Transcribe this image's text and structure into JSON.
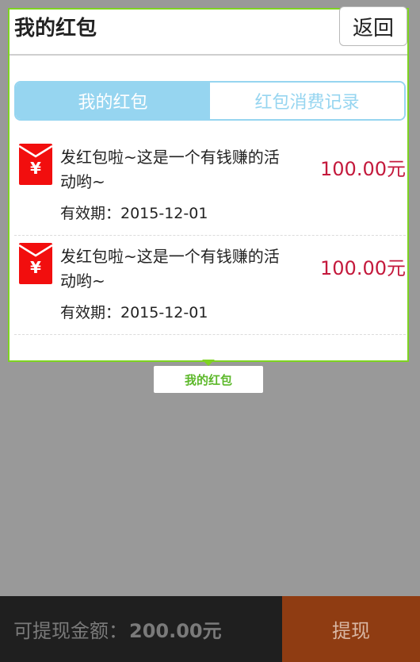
{
  "header": {
    "title": "我的红包",
    "back_label": "返回"
  },
  "tabs": [
    {
      "label": "我的红包",
      "active": true
    },
    {
      "label": "红包消费记录",
      "active": false
    }
  ],
  "envelopes": [
    {
      "description": "发红包啦~这是一个有钱赚的活动哟~",
      "expiry": "有效期：2015-12-01",
      "amount": "100.00元"
    },
    {
      "description": "发红包啦~这是一个有钱赚的活动哟~",
      "expiry": "有效期：2015-12-01",
      "amount": "100.00元"
    }
  ],
  "icon": {
    "envelope_symbol": "¥"
  },
  "tooltip": {
    "label": "我的红包"
  },
  "footer": {
    "balance_label": "可提现金额：",
    "balance_value": "200.00元",
    "withdraw_label": "提现"
  },
  "colors": {
    "highlight_border": "#7ed321",
    "tab_accent": "#96d5f0",
    "amount": "#c4193c",
    "envelope_red": "#f20e0e",
    "withdraw_bg": "#8f3c12"
  }
}
